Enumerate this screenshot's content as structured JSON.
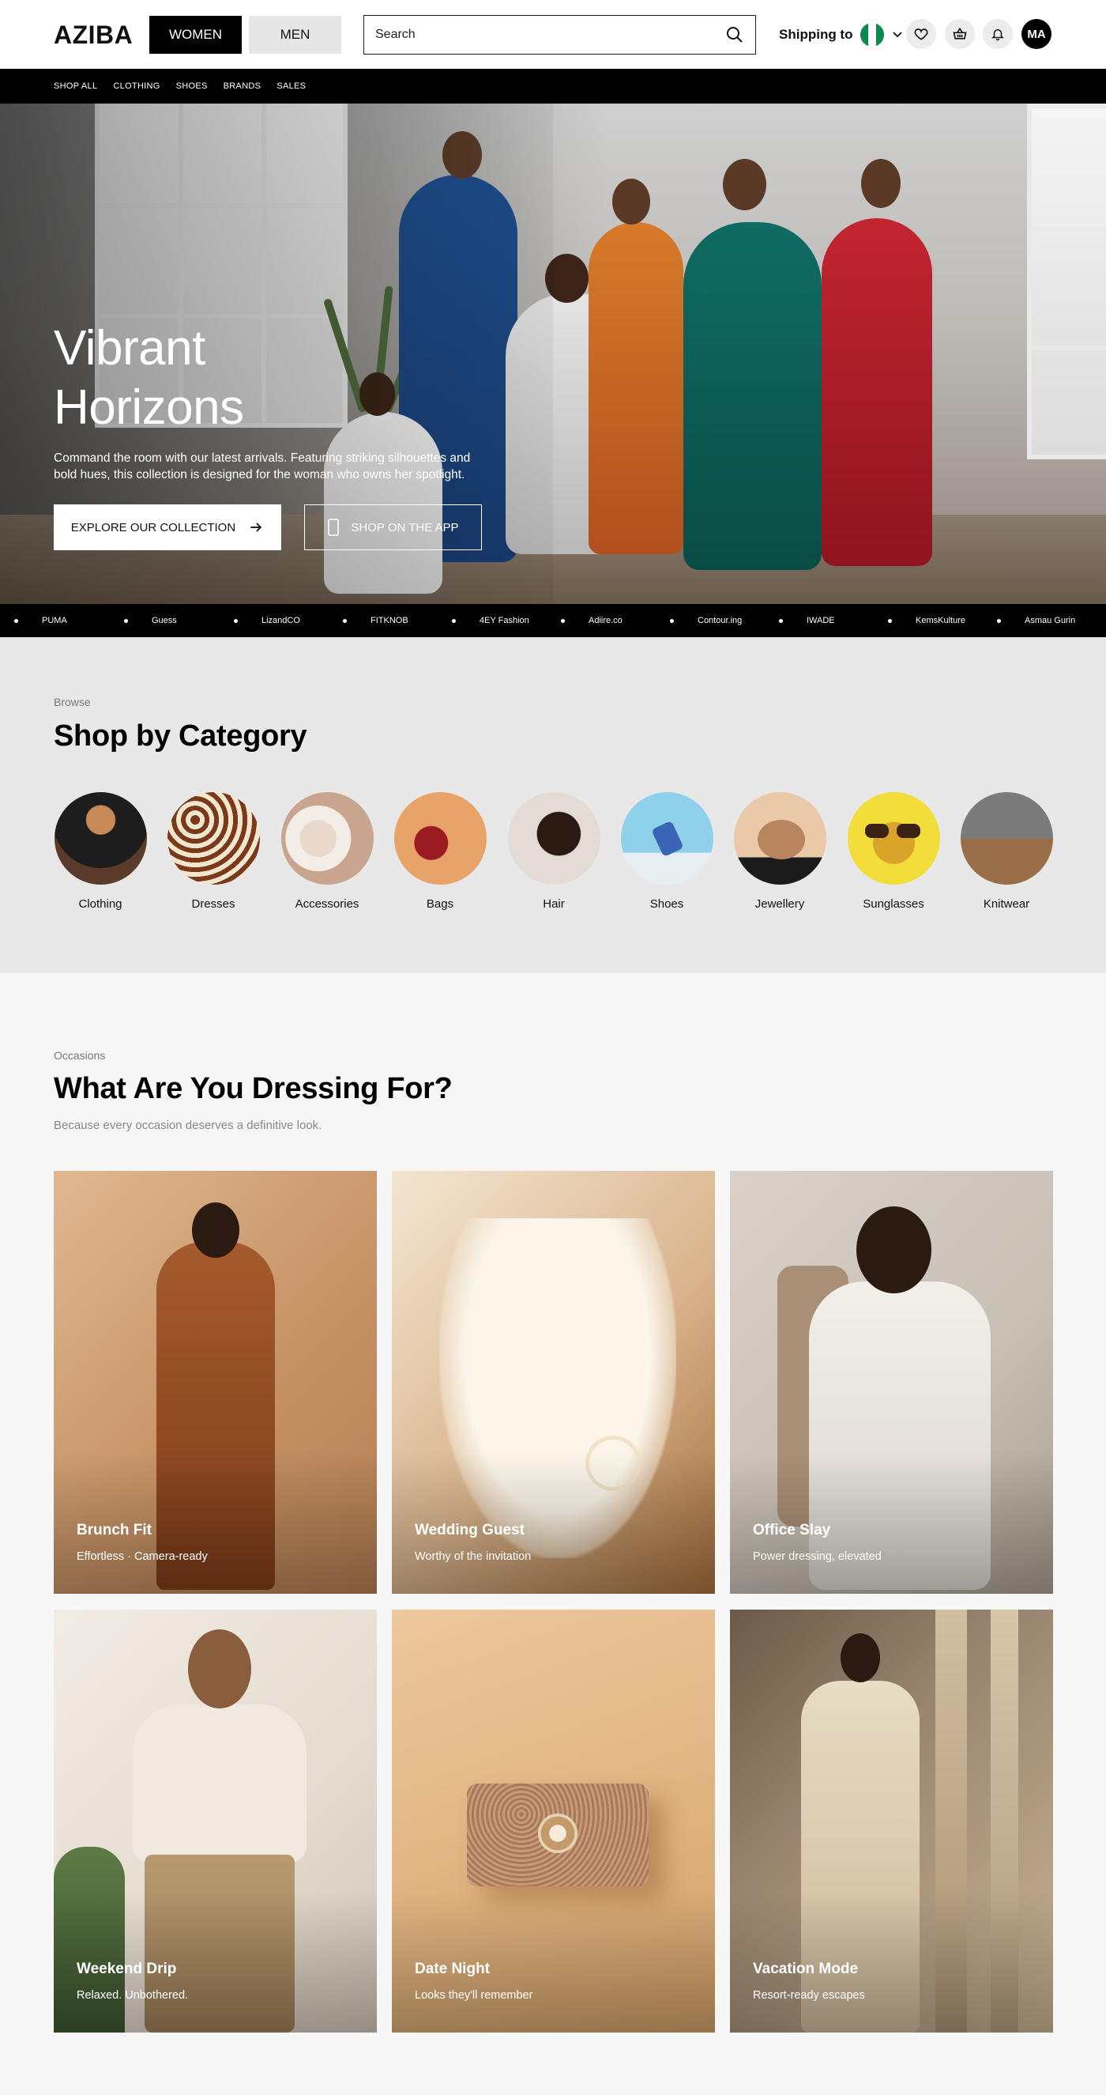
{
  "header": {
    "logo": "AZIBA",
    "tabs": [
      {
        "label": "WOMEN",
        "active": true
      },
      {
        "label": "MEN",
        "active": false
      }
    ],
    "search_placeholder": "Search",
    "shipping_label": "Shipping to",
    "shipping_country_flag": "nigeria-flag",
    "icons": [
      "heart-icon",
      "basket-icon",
      "bell-icon"
    ],
    "avatar_initials": "MA"
  },
  "nav": {
    "items": [
      "SHOP ALL",
      "CLOTHING",
      "SHOES",
      "BRANDS",
      "SALES"
    ]
  },
  "hero": {
    "title_line1": "Vibrant",
    "title_line2": "Horizons",
    "subtitle": "Command the room with our latest arrivals. Featuring striking silhouettes and bold hues, this collection is designed for the woman who owns her spotlight.",
    "primary_cta": "EXPLORE OUR COLLECTION",
    "secondary_cta": "SHOP ON THE APP"
  },
  "brands": [
    "PUMA",
    "Guess",
    "LizandCO",
    "FITKNOB",
    "4EY Fashion",
    "Adiire.co",
    "Contour.ing",
    "IWADE",
    "KemsKulture",
    "Asmau Gurin"
  ],
  "categories": {
    "eyebrow": "Browse",
    "title": "Shop by Category",
    "items": [
      "Clothing",
      "Dresses",
      "Accessories",
      "Bags",
      "Hair",
      "Shoes",
      "Jewellery",
      "Sunglasses",
      "Knitwear"
    ]
  },
  "occasions": {
    "eyebrow": "Occasions",
    "title": "What Are You Dressing For?",
    "subtitle": "Because every occasion deserves a definitive look.",
    "cards": [
      {
        "title": "Brunch Fit",
        "subtitle": "Effortless · Camera-ready"
      },
      {
        "title": "Wedding Guest",
        "subtitle": "Worthy of the invitation"
      },
      {
        "title": "Office Slay",
        "subtitle": "Power dressing, elevated"
      },
      {
        "title": "Weekend Drip",
        "subtitle": "Relaxed. Unbothered."
      },
      {
        "title": "Date Night",
        "subtitle": "Looks they'll remember"
      },
      {
        "title": "Vacation Mode",
        "subtitle": "Resort-ready escapes"
      }
    ]
  },
  "colors": {
    "primary": "#000000",
    "nigeria_green": "#0a8a4a",
    "section_bg": "#e8e8e8"
  }
}
